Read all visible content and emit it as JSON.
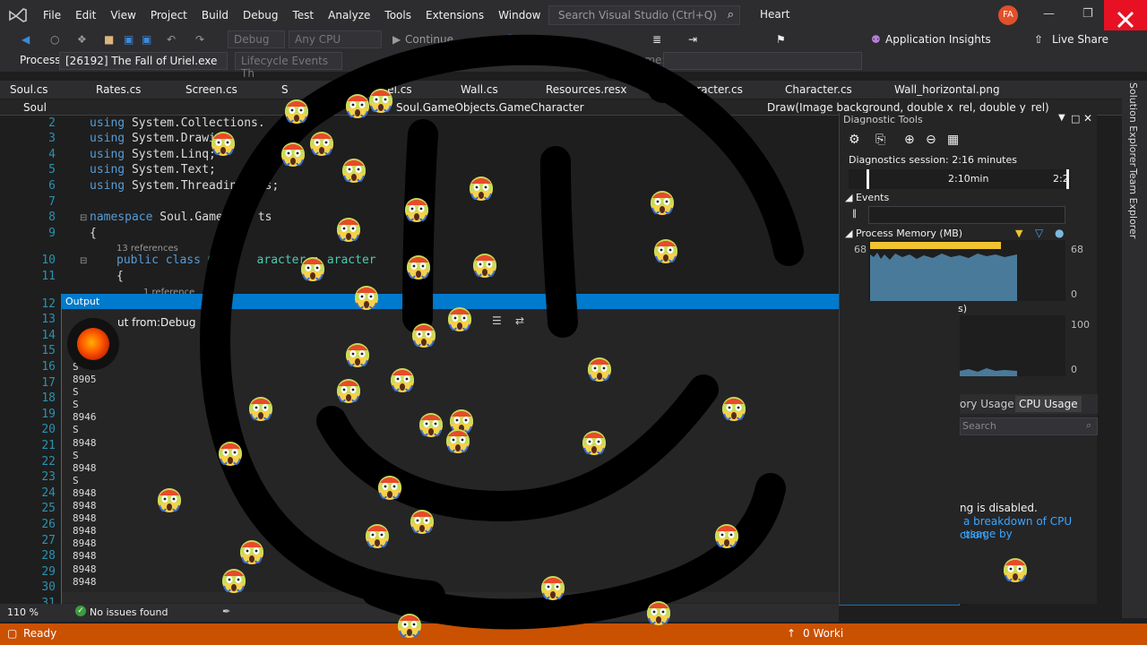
{
  "menubar": {
    "items": [
      "File",
      "Edit",
      "View",
      "Project",
      "Build",
      "Debug",
      "Test",
      "Analyze",
      "Tools",
      "Extensions",
      "Window",
      "Help"
    ],
    "search_placeholder": "Search Visual Studio (Ctrl+Q)",
    "solution_name": "Heart",
    "avatar_initials": "FA"
  },
  "toolbar": {
    "config": "Debug",
    "platform": "Any CPU",
    "continue_label": "Continue",
    "app_insights": "Application Insights",
    "live_share": "Live Share"
  },
  "toolbar2": {
    "process_label": "Process:",
    "process_value": "[26192] The Fall of Uriel.exe",
    "lifecycle_label": "Lifecycle Events",
    "lifecycle_trailing": "Th",
    "frame_label": "Frame:"
  },
  "tabs": [
    "Soul.cs",
    "Rates.cs",
    "Screen.cs",
    "S",
    "riel.cs",
    "Wall.cs",
    "Resources.resx",
    "aracter.cs",
    "Character.cs",
    "Wall_horizontal.png"
  ],
  "navbar": {
    "left": "Soul",
    "middle": "Soul.GameObjects.GameCharacter",
    "right": "Draw(Image background, double x_rel, double y_rel)"
  },
  "editor": {
    "line_numbers": [
      "2",
      "3",
      "4",
      "5",
      "6",
      "7",
      "8",
      "9",
      "10",
      "11",
      "12",
      "13",
      "14",
      "15",
      "16",
      "17",
      "18",
      "19",
      "20",
      "21",
      "22",
      "23",
      "24",
      "25",
      "26",
      "27",
      "28",
      "29",
      "30",
      "31"
    ],
    "using_kw": "using",
    "usings": [
      "System.Collections.",
      "System.Drawi",
      "System.Linq;",
      "System.Text;",
      "System.Threadin  sks;"
    ],
    "namespace_kw": "namespace",
    "namespace_name": "Soul.GameC    ts",
    "brace": "{",
    "refs_13": "13 references",
    "public_kw": "public",
    "class_kw": "class",
    "class_name": "G      aracter",
    "colon": ":",
    "base_class": "aracter",
    "refs_1": "1 reference"
  },
  "output": {
    "title": "Output",
    "show_from_label": "ut from:",
    "show_from_value": "Debug",
    "lines": [
      "S",
      "8905",
      "S",
      "S",
      "8946",
      "S",
      "8948",
      "S",
      "8948",
      "S",
      "8948",
      "8948",
      "8948",
      "8948",
      "8948",
      "8948",
      "8948",
      "8948"
    ]
  },
  "diagnostics": {
    "title": "Diagnostic Tools",
    "session": "Diagnostics session: 2:16 minutes",
    "timeline_label_1": "2:10min",
    "timeline_label_2": "2:2",
    "events_label": "Events",
    "memory_label": "Process Memory (MB)",
    "mem_max_left": "68",
    "mem_max_right": "68",
    "mem_zero_right": "0",
    "cpu_label_partial": "s)",
    "cpu_max": "100",
    "cpu_zero": "0",
    "tab_memory": "ory Usage",
    "tab_cpu": "CPU Usage",
    "search_placeholder": "Search",
    "disabled_text": "ng is disabled.",
    "link_line1": "a breakdown of CPU usage by",
    "link_line2": "ction."
  },
  "right_rail": {
    "solution_explorer": "Solution Explorer",
    "team_explorer": "Team Explorer"
  },
  "status_top": {
    "zoom": "110 %",
    "issues": "No issues found"
  },
  "statusbar": {
    "ready": "Ready",
    "working": "0 Worki"
  },
  "colors": {
    "accent": "#007acc",
    "status_bar": "#ca5100",
    "close_button": "#e81123",
    "memory_bar": "#f0c430",
    "memory_graph": "#4a7a99"
  }
}
